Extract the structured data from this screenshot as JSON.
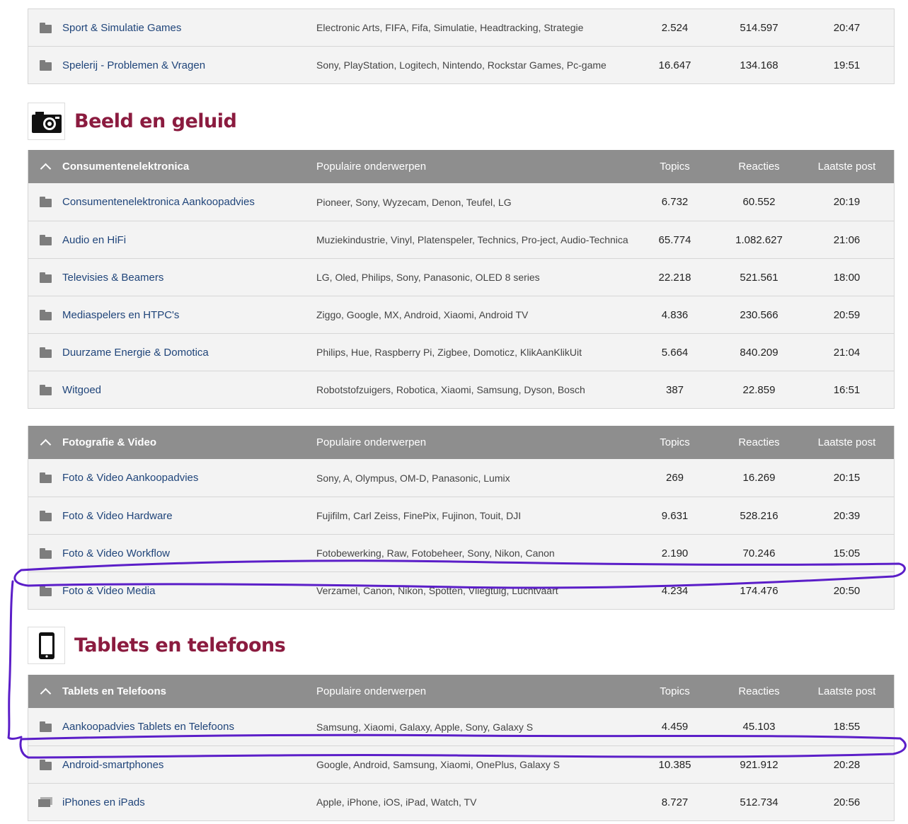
{
  "top_table": {
    "rows": [
      {
        "name": "Sport & Simulatie Games",
        "popular": "Electronic Arts, FIFA, Fifa, Simulatie, Headtracking, Strategie",
        "topics": "2.524",
        "reacties": "514.597",
        "last": "20:47"
      },
      {
        "name": "Spelerij - Problemen & Vragen",
        "popular": "Sony, PlayStation, Logitech, Nintendo, Rockstar Games, Pc-game",
        "topics": "16.647",
        "reacties": "134.168",
        "last": "19:51"
      }
    ]
  },
  "section_beeld": {
    "title": "Beeld en geluid",
    "icon": "camera-icon"
  },
  "table_consumenten": {
    "header": {
      "name": "Consumentenelektronica",
      "popular": "Populaire onderwerpen",
      "topics": "Topics",
      "reacties": "Reacties",
      "last": "Laatste post"
    },
    "rows": [
      {
        "name": "Consumentenelektronica Aankoopadvies",
        "popular": "Pioneer, Sony, Wyzecam, Denon, Teufel, LG",
        "topics": "6.732",
        "reacties": "60.552",
        "last": "20:19"
      },
      {
        "name": "Audio en HiFi",
        "popular": "Muziekindustrie, Vinyl, Platenspeler, Technics, Pro-ject, Audio-Technica",
        "topics": "65.774",
        "reacties": "1.082.627",
        "last": "21:06"
      },
      {
        "name": "Televisies & Beamers",
        "popular": "LG, Oled, Philips, Sony, Panasonic, OLED 8 series",
        "topics": "22.218",
        "reacties": "521.561",
        "last": "18:00"
      },
      {
        "name": "Mediaspelers en HTPC's",
        "popular": "Ziggo, Google, MX, Android, Xiaomi, Android TV",
        "topics": "4.836",
        "reacties": "230.566",
        "last": "20:59"
      },
      {
        "name": "Duurzame Energie & Domotica",
        "popular": "Philips, Hue, Raspberry Pi, Zigbee, Domoticz, KlikAanKlikUit",
        "topics": "5.664",
        "reacties": "840.209",
        "last": "21:04"
      },
      {
        "name": "Witgoed",
        "popular": "Robotstofzuigers, Robotica, Xiaomi, Samsung, Dyson, Bosch",
        "topics": "387",
        "reacties": "22.859",
        "last": "16:51"
      }
    ]
  },
  "table_foto": {
    "header": {
      "name": "Fotografie & Video",
      "popular": "Populaire onderwerpen",
      "topics": "Topics",
      "reacties": "Reacties",
      "last": "Laatste post"
    },
    "rows": [
      {
        "name": "Foto & Video Aankoopadvies",
        "popular": "Sony, A, Olympus, OM-D, Panasonic, Lumix",
        "topics": "269",
        "reacties": "16.269",
        "last": "20:15"
      },
      {
        "name": "Foto & Video Hardware",
        "popular": "Fujifilm, Carl Zeiss, FinePix, Fujinon, Touit, DJI",
        "topics": "9.631",
        "reacties": "528.216",
        "last": "20:39"
      },
      {
        "name": "Foto & Video Workflow",
        "popular": "Fotobewerking, Raw, Fotobeheer, Sony, Nikon, Canon",
        "topics": "2.190",
        "reacties": "70.246",
        "last": "15:05"
      },
      {
        "name": "Foto & Video Media",
        "popular": "Verzamel, Canon, Nikon, Spotten, Vliegtuig, Luchtvaart",
        "topics": "4.234",
        "reacties": "174.476",
        "last": "20:50"
      }
    ]
  },
  "section_tablets": {
    "title": "Tablets en telefoons",
    "icon": "smartphone-icon"
  },
  "table_tablets": {
    "header": {
      "name": "Tablets en Telefoons",
      "popular": "Populaire onderwerpen",
      "topics": "Topics",
      "reacties": "Reacties",
      "last": "Laatste post"
    },
    "rows": [
      {
        "name": "Aankoopadvies Tablets en Telefoons",
        "popular": "Samsung, Xiaomi, Galaxy, Apple, Sony, Galaxy S",
        "topics": "4.459",
        "reacties": "45.103",
        "last": "18:55"
      },
      {
        "name": "Android-smartphones",
        "popular": "Google, Android, Samsung, Xiaomi, OnePlus, Galaxy S",
        "topics": "10.385",
        "reacties": "921.912",
        "last": "20:28"
      },
      {
        "name": "iPhones en iPads",
        "popular": "Apple, iPhone, iOS, iPad, Watch, TV",
        "topics": "8.727",
        "reacties": "512.734",
        "last": "20:56"
      }
    ]
  },
  "colors": {
    "accent": "#8b1b3f",
    "link": "#20457a",
    "header_bg": "#8e8e8e",
    "row_bg": "#f3f3f3",
    "annotation": "#5b1ec8"
  }
}
